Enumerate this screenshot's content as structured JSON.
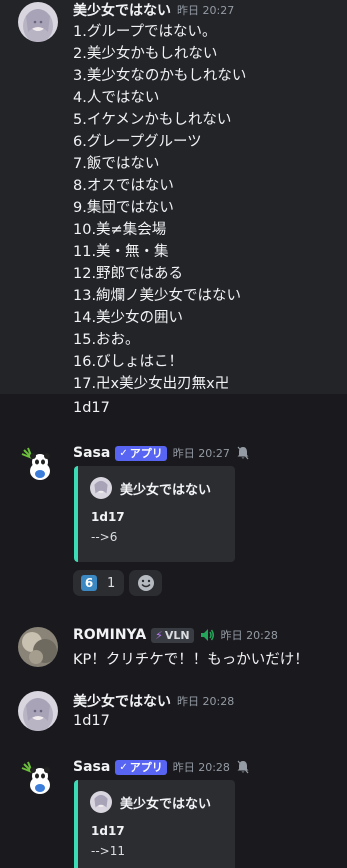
{
  "messages": [
    {
      "username": "美少女ではない",
      "timestamp": "昨日 20:27",
      "lines": [
        "1.グループではない。",
        "2.美少女かもしれない",
        "3.美少女なのかもしれない",
        "4.人ではない",
        "5.イケメンかもしれない",
        "6.グレープグルーツ",
        "7.飯ではない",
        "8.オスではない",
        "9.集団ではない",
        "10.美≠集会場",
        "11.美・無・集",
        "12.野郎ではある",
        "13.絢爛ノ美少女ではない",
        "14.美少女の囲い",
        "15.おお。",
        "16.びしょはこ！",
        "17.卍x美少女出刃無x卍"
      ]
    },
    {
      "text": "1d17"
    },
    {
      "username": "Sasa",
      "badge": "アプリ",
      "timestamp": "昨日 20:27",
      "embed": {
        "author": "美少女ではない",
        "title": "1d17",
        "description": "-->6"
      },
      "reactions": [
        {
          "emoji": "6",
          "count": "1"
        }
      ]
    },
    {
      "username": "ROMINYA",
      "badge": "VLN",
      "timestamp": "昨日 20:28",
      "text": "KP！クリチケで！！もっかいだけ！"
    },
    {
      "username": "美少女ではない",
      "timestamp": "昨日 20:28",
      "text": "1d17"
    },
    {
      "username": "Sasa",
      "badge": "アプリ",
      "timestamp": "昨日 20:28",
      "embed": {
        "author": "美少女ではない",
        "title": "1d17",
        "description": "-->11"
      }
    }
  ],
  "colors": {
    "background": "#1a1a1e",
    "hover_background": "#232428",
    "embed_accent": "#3ddbb5",
    "app_badge": "#5865f2"
  },
  "icons": {
    "app_check": "✓",
    "vln_bolt": "⚡",
    "bell": "bell-icon",
    "speaker": "speaker-icon",
    "add_reaction": "emoji-add-icon"
  }
}
